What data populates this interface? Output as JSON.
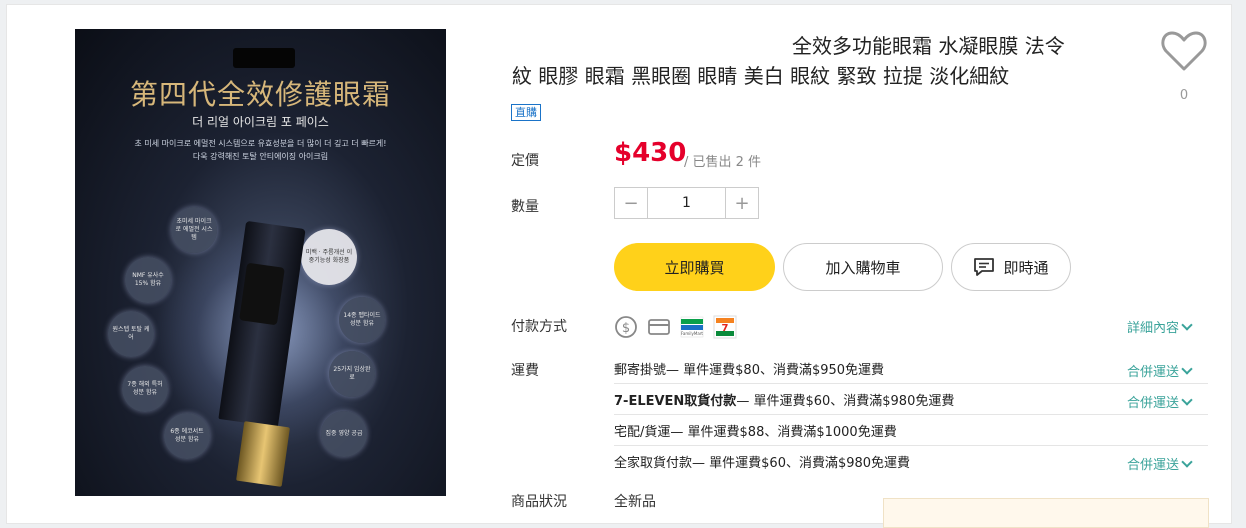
{
  "product": {
    "title_line1": "全效多功能眼霜 水凝眼膜 法令",
    "title_line2": "紋 眼膠 眼霜 黑眼圈 眼睛 美白 眼紋 緊致 拉提 淡化細紋",
    "badge": "直購",
    "favorite_count": "0"
  },
  "image": {
    "title": "第四代全效修護眼霜",
    "subtitle": "더 리얼 아이크림 포 페이스",
    "copy_line1": "초 미세 마이크로 에멀전 시스템으로 유효성분을 더 많이 더 깊고 더 빠르게!",
    "copy_line2": "다욱 강력해진 토탈 안티에이징 아이크림",
    "bubbles": {
      "b1": "초미세 마이크로 에멀전 시스템",
      "b2": "NMF 유사수 15% 함유",
      "b3": "미백 · 주름개선 이중기능성 화장품",
      "b4": "14종 펩타이드 성분 함유",
      "b5": "원스텝 토탈 케어",
      "b6": "25가지 임상완료",
      "b7": "7종 해외 특허 성분 함유",
      "b8": "6종 에코서트 성분 함유",
      "b9": "집중 영양 공급"
    }
  },
  "price": {
    "label": "定價",
    "value": "$430",
    "sold": "/ 已售出 2 件"
  },
  "quantity": {
    "label": "數量",
    "value": "1",
    "minus": "−",
    "plus": "+"
  },
  "buttons": {
    "buy": "立即購買",
    "cart": "加入購物車",
    "chat": "即時通"
  },
  "payment": {
    "label": "付款方式",
    "icons": [
      "dollar-icon",
      "credit-card-icon",
      "familymart-icon",
      "seven-eleven-icon"
    ],
    "detail_link": "詳細內容"
  },
  "shipping": {
    "label": "運費",
    "rows": [
      {
        "method": "郵寄掛號",
        "desc": " — 單件運費$80、消費滿$950免運費",
        "bold": false,
        "link": "合併運送"
      },
      {
        "method": "7-ELEVEN取貨付款",
        "desc": " — 單件運費$60、消費滿$980免運費",
        "bold": true,
        "link": "合併運送"
      },
      {
        "method": "宅配/貨運",
        "desc": " — 單件運費$88、消費滿$1000免運費",
        "bold": false,
        "link": ""
      },
      {
        "method": "全家取貨付款",
        "desc": " — 單件運費$60、消費滿$980免運費",
        "bold": false,
        "link": "合併運送"
      }
    ]
  },
  "condition": {
    "label": "商品狀況",
    "value": "全新品"
  },
  "colors": {
    "price": "#e5002b",
    "buy_button": "#ffd11a",
    "link": "#3aa39a",
    "badge": "#1a73c8"
  }
}
